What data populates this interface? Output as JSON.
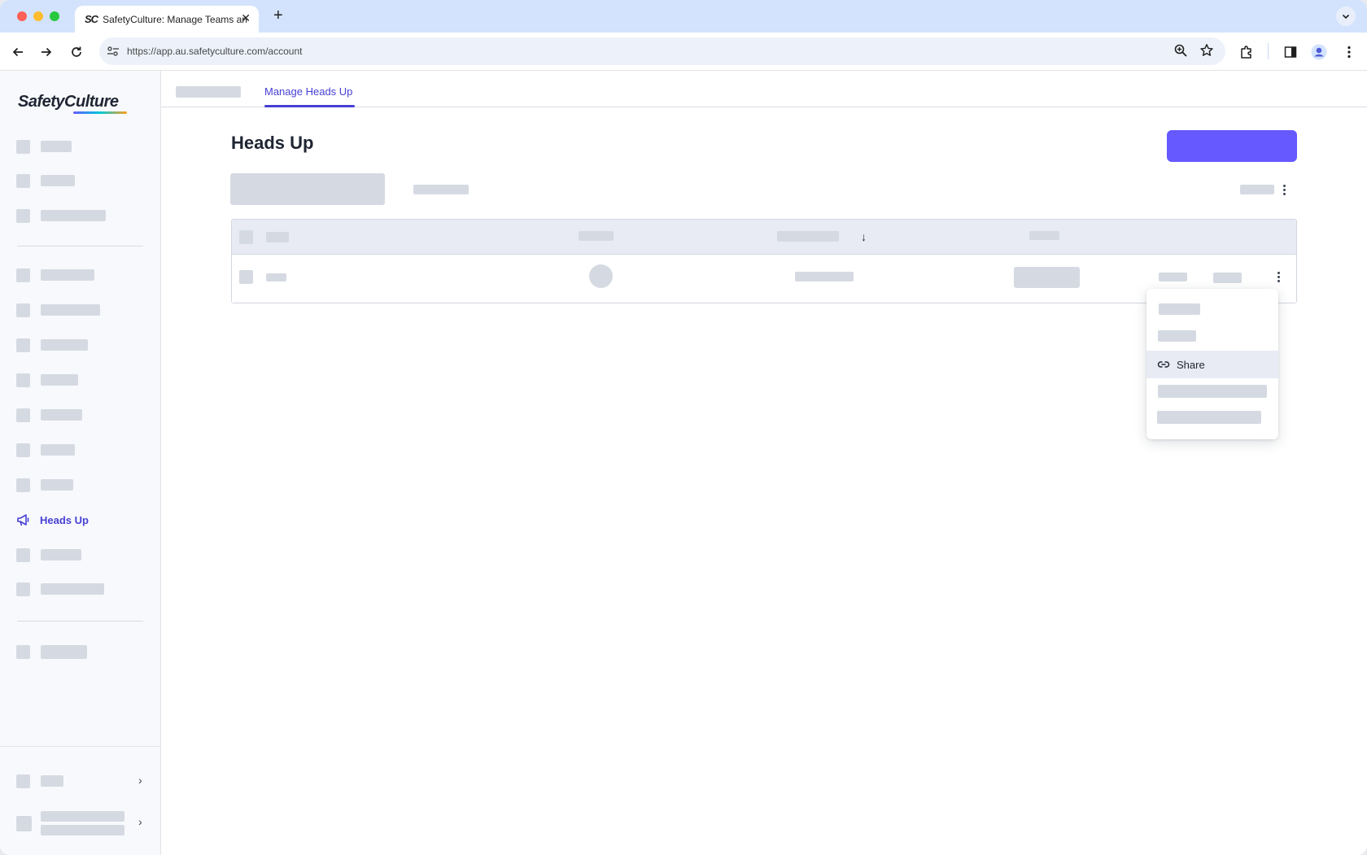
{
  "browser": {
    "tab_title": "SafetyCulture: Manage Teams and...",
    "tab_favicon": "SC",
    "url": "https://app.au.safetyculture.com/account"
  },
  "sidebar": {
    "logo": "SafetyCulture",
    "active_item": {
      "label": "Heads Up",
      "icon": "megaphone-icon"
    }
  },
  "main": {
    "tabs": [
      {
        "label": "Manage Heads Up",
        "active": true
      }
    ],
    "page_title": "Heads Up"
  },
  "dropdown": {
    "items": [
      {
        "label": "Share",
        "icon": "link-icon",
        "hovered": true
      }
    ]
  },
  "colors": {
    "accent": "#4740d4",
    "primary_button": "#6559ff",
    "placeholder": "#d5dae2",
    "tab_strip": "#d3e3fd"
  }
}
